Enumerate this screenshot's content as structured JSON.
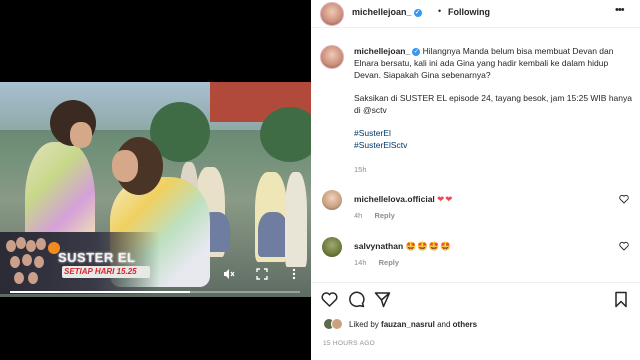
{
  "post": {
    "username": "michellejoan_",
    "following_label": "Following",
    "more_label": "•••",
    "caption": {
      "text1": "Hilangnya Manda belum bisa membuat Devan dan Elnara bersatu, kali ini ada Gina yang hadir kembali ke dalam hidup Devan. Siapakah Gina sebenarnya?",
      "text2": "Saksikan di SUSTER EL episode 24, tayang besok, jam 15:25 WIB hanya di @sctv",
      "hashtags": [
        "#SusterEl",
        "#SusterElSctv"
      ],
      "time": "15h"
    },
    "comments": [
      {
        "username": "michellelova.official",
        "text": "❤❤",
        "age": "4h",
        "reply_label": "Reply",
        "avatar_color": "#d8b89a"
      },
      {
        "username": "salvynathan",
        "text": "🤩🤩🤩🤩",
        "age": "14h",
        "reply_label": "Reply",
        "avatar_color": "#6b7a3a"
      }
    ],
    "likes": {
      "prefix": "Liked by",
      "user": "fauzan_nasrul",
      "and": "and",
      "others": "others"
    },
    "timestamp": "15 HOURS AGO"
  },
  "video": {
    "show_title": "SUSTER EL",
    "show_subtitle": "SETIAP HARI 15.25",
    "progress": 0.62,
    "mute_icon": "speaker-muted-icon",
    "fullscreen_icon": "fullscreen-icon",
    "menu_icon": "more-vertical-icon"
  },
  "colors": {
    "link": "#00376b",
    "verified": "#3897f0",
    "muted_text": "#8e8e8e"
  }
}
